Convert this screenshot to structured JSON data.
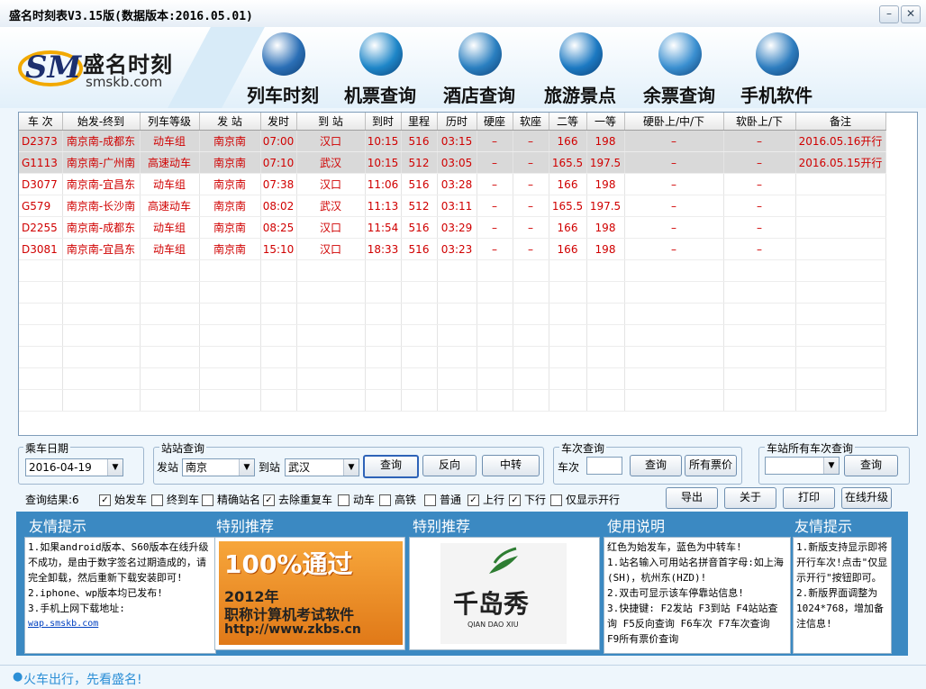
{
  "window": {
    "title": "盛名时刻表V3.15版(数据版本:2016.05.01)",
    "minimize_glyph": "–",
    "close_glyph": "✕"
  },
  "brand": {
    "logo_text": "SM",
    "name": "盛名时刻",
    "url": "smskb.com"
  },
  "nav": [
    {
      "label": "列车时刻",
      "icon": "train-icon",
      "color": "#2b6fb6"
    },
    {
      "label": "机票查询",
      "icon": "airplane-icon",
      "color": "#1e86c8"
    },
    {
      "label": "酒店查询",
      "icon": "hotel-icon",
      "color": "#2a7fc0"
    },
    {
      "label": "旅游景点",
      "icon": "globe-icon",
      "color": "#1c79c2"
    },
    {
      "label": "余票查询",
      "icon": "windows-icon",
      "color": "#3a8fd0"
    },
    {
      "label": "手机软件",
      "icon": "java-icon",
      "color": "#2e7dbf"
    }
  ],
  "table": {
    "columns": [
      "车 次",
      "始发-终到",
      "列车等级",
      "发 站",
      "发时",
      "到 站",
      "到时",
      "里程",
      "历时",
      "硬座",
      "软座",
      "二等",
      "一等",
      "硬卧上/中/下",
      "软卧上/下",
      "备注"
    ],
    "rows": [
      [
        "D2373",
        "南京南-成都东",
        "动车组",
        "南京南",
        "07:00",
        "汉口",
        "10:15",
        "516",
        "03:15",
        "–",
        "–",
        "166",
        "198",
        "–",
        "–",
        "2016.05.16开行"
      ],
      [
        "G1113",
        "南京南-广州南",
        "高速动车",
        "南京南",
        "07:10",
        "武汉",
        "10:15",
        "512",
        "03:05",
        "–",
        "–",
        "165.5",
        "197.5",
        "–",
        "–",
        "2016.05.15开行"
      ],
      [
        "D3077",
        "南京南-宜昌东",
        "动车组",
        "南京南",
        "07:38",
        "汉口",
        "11:06",
        "516",
        "03:28",
        "–",
        "–",
        "166",
        "198",
        "–",
        "–",
        ""
      ],
      [
        "G579",
        "南京南-长沙南",
        "高速动车",
        "南京南",
        "08:02",
        "武汉",
        "11:13",
        "512",
        "03:11",
        "–",
        "–",
        "165.5",
        "197.5",
        "–",
        "–",
        ""
      ],
      [
        "D2255",
        "南京南-成都东",
        "动车组",
        "南京南",
        "08:25",
        "汉口",
        "11:54",
        "516",
        "03:29",
        "–",
        "–",
        "166",
        "198",
        "–",
        "–",
        ""
      ],
      [
        "D3081",
        "南京南-宜昌东",
        "动车组",
        "南京南",
        "15:10",
        "汉口",
        "18:33",
        "516",
        "03:23",
        "–",
        "–",
        "166",
        "198",
        "–",
        "–",
        ""
      ]
    ],
    "highlighted_rows": [
      0,
      1
    ]
  },
  "date_group": {
    "label": "乘车日期",
    "value": "2016-04-19"
  },
  "station_group": {
    "label": "站站查询",
    "from_label": "发站",
    "from_value": "南京",
    "to_label": "到站",
    "to_value": "武汉",
    "query": "查询",
    "reverse": "反向",
    "transfer": "中转"
  },
  "train_group": {
    "label": "车次查询",
    "field_label": "车次",
    "field_value": "",
    "query": "查询",
    "all_fares": "所有票价"
  },
  "station_all_group": {
    "label": "车站所有车次查询",
    "value": "",
    "query": "查询"
  },
  "filters": {
    "result_label": "查询结果:6",
    "items": [
      {
        "label": "始发车",
        "checked": true
      },
      {
        "label": "终到车",
        "checked": false
      },
      {
        "label": "精确站名",
        "checked": false
      },
      {
        "label": "去除重复车",
        "checked": true
      },
      {
        "label": "动车",
        "checked": false
      },
      {
        "label": "高铁",
        "checked": false
      },
      {
        "label": "普通",
        "checked": false
      },
      {
        "label": "上行",
        "checked": true
      },
      {
        "label": "下行",
        "checked": true
      },
      {
        "label": "仅显示开行",
        "checked": false
      }
    ],
    "check_glyph": "✓"
  },
  "actions": {
    "export": "导出",
    "about": "关于",
    "print": "打印",
    "upgrade": "在线升级"
  },
  "panels": {
    "tip1": {
      "title": "友情提示",
      "lines": [
        "1.如果android版本、S60版本在线升级不成功，是由于数字签名过期造成的，请完全卸载，然后重新下载安装即可!",
        "2.iphone、wp版本均已发布!",
        "3.手机上网下载地址:"
      ],
      "link": "wap.smskb.com"
    },
    "promo1": {
      "title": "特别推荐",
      "big": "100%通过",
      "year": "2012年",
      "line": "职称计算机考试软件",
      "url": "http://www.zkbs.cn"
    },
    "promo2": {
      "title": "特别推荐",
      "logo": "千岛秀",
      "logo_sub": "QIAN DAO XIU"
    },
    "usage": {
      "title": "使用说明",
      "lines": [
        "红色为始发车，蓝色为中转车!",
        "1.站名输入可用站名拼音首字母:如上海(SH)，杭州东(HZD)!",
        "2.双击可显示该车停靠站信息!",
        "3.快捷键: F2发站 F3到站 F4站站查询 F5反向查询 F6车次 F7车次查询 F9所有票价查询"
      ]
    },
    "tip2": {
      "title": "友情提示",
      "lines": [
        "1.新版支持显示即将开行车次!点击\"仅显示开行\"按钮即可。",
        "2.新版界面调整为1024*768，增加备注信息!"
      ]
    }
  },
  "status": {
    "text": "火车出行，先看盛名!"
  }
}
